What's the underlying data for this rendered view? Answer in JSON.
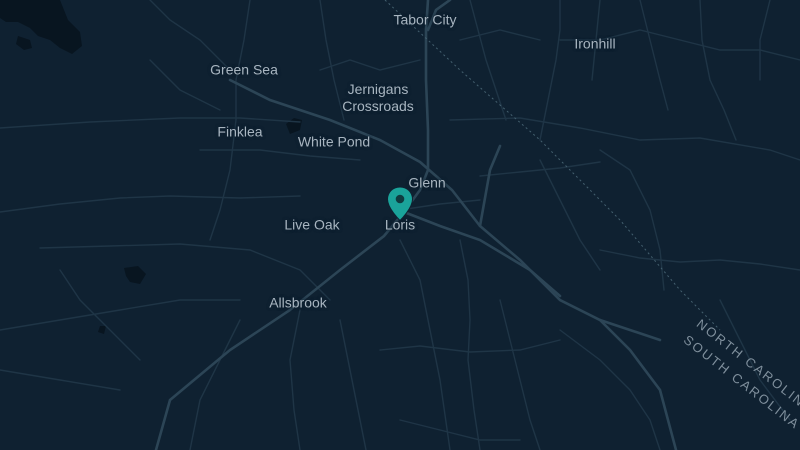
{
  "map": {
    "places": [
      {
        "id": "tabor-city",
        "name": "Tabor City"
      },
      {
        "id": "ironhill",
        "name": "Ironhill"
      },
      {
        "id": "green-sea",
        "name": "Green Sea"
      },
      {
        "id": "jernigans-crossroads",
        "name": "Jernigans\nCrossroads"
      },
      {
        "id": "finklea",
        "name": "Finklea"
      },
      {
        "id": "white-pond",
        "name": "White Pond"
      },
      {
        "id": "glenn",
        "name": "Glenn"
      },
      {
        "id": "live-oak",
        "name": "Live Oak"
      },
      {
        "id": "loris",
        "name": "Loris"
      },
      {
        "id": "allsbrook",
        "name": "Allsbrook"
      }
    ],
    "states": {
      "north": "NORTH CAROLINA",
      "south": "SOUTH CAROLINA"
    },
    "marker": {
      "label": "location-pin-icon",
      "color": "#1aa39a"
    },
    "colors": {
      "background": "#0f2131",
      "major_road": "#2c4556",
      "minor_road": "#1f3546",
      "water": "#081520",
      "label": "#a8b5c0"
    }
  }
}
